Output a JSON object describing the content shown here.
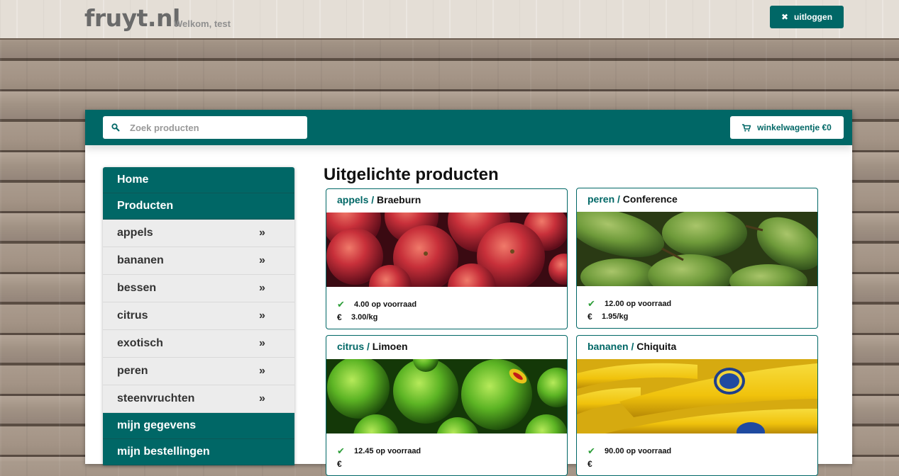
{
  "header": {
    "logo": "fruyt.nl",
    "welcome": "Welkom, test",
    "logout_label": "uitloggen"
  },
  "toolbar": {
    "search_placeholder": "Zoek producten",
    "search_value": "",
    "cart_label": "winkelwagentje €0"
  },
  "sidebar": {
    "home": "Home",
    "products": "Producten",
    "categories": [
      "appels",
      "bananen",
      "bessen",
      "citrus",
      "exotisch",
      "peren",
      "steenvruchten"
    ],
    "chevron_glyph": "»",
    "account": "mijn gegevens",
    "orders": "mijn bestellingen"
  },
  "main": {
    "title": "Uitgelichte producten",
    "stock_icon": "check-icon",
    "products": [
      {
        "category": "appels",
        "separator": " / ",
        "name": "Braeburn",
        "stock": "4.00 op voorraad",
        "currency": "€",
        "price": "3.00/kg"
      },
      {
        "category": "peren",
        "separator": " / ",
        "name": "Conference",
        "stock": "12.00 op voorraad",
        "currency": "€",
        "price": "1.95/kg"
      },
      {
        "category": "citrus",
        "separator": " / ",
        "name": "Limoen",
        "stock": "12.45 op voorraad",
        "currency": "€",
        "price": ""
      },
      {
        "category": "bananen",
        "separator": " / ",
        "name": "Chiquita",
        "stock": "90.00 op voorraad",
        "currency": "€",
        "price": ""
      }
    ]
  },
  "colors": {
    "brand": "#006766",
    "check": "#2e9e3a"
  }
}
